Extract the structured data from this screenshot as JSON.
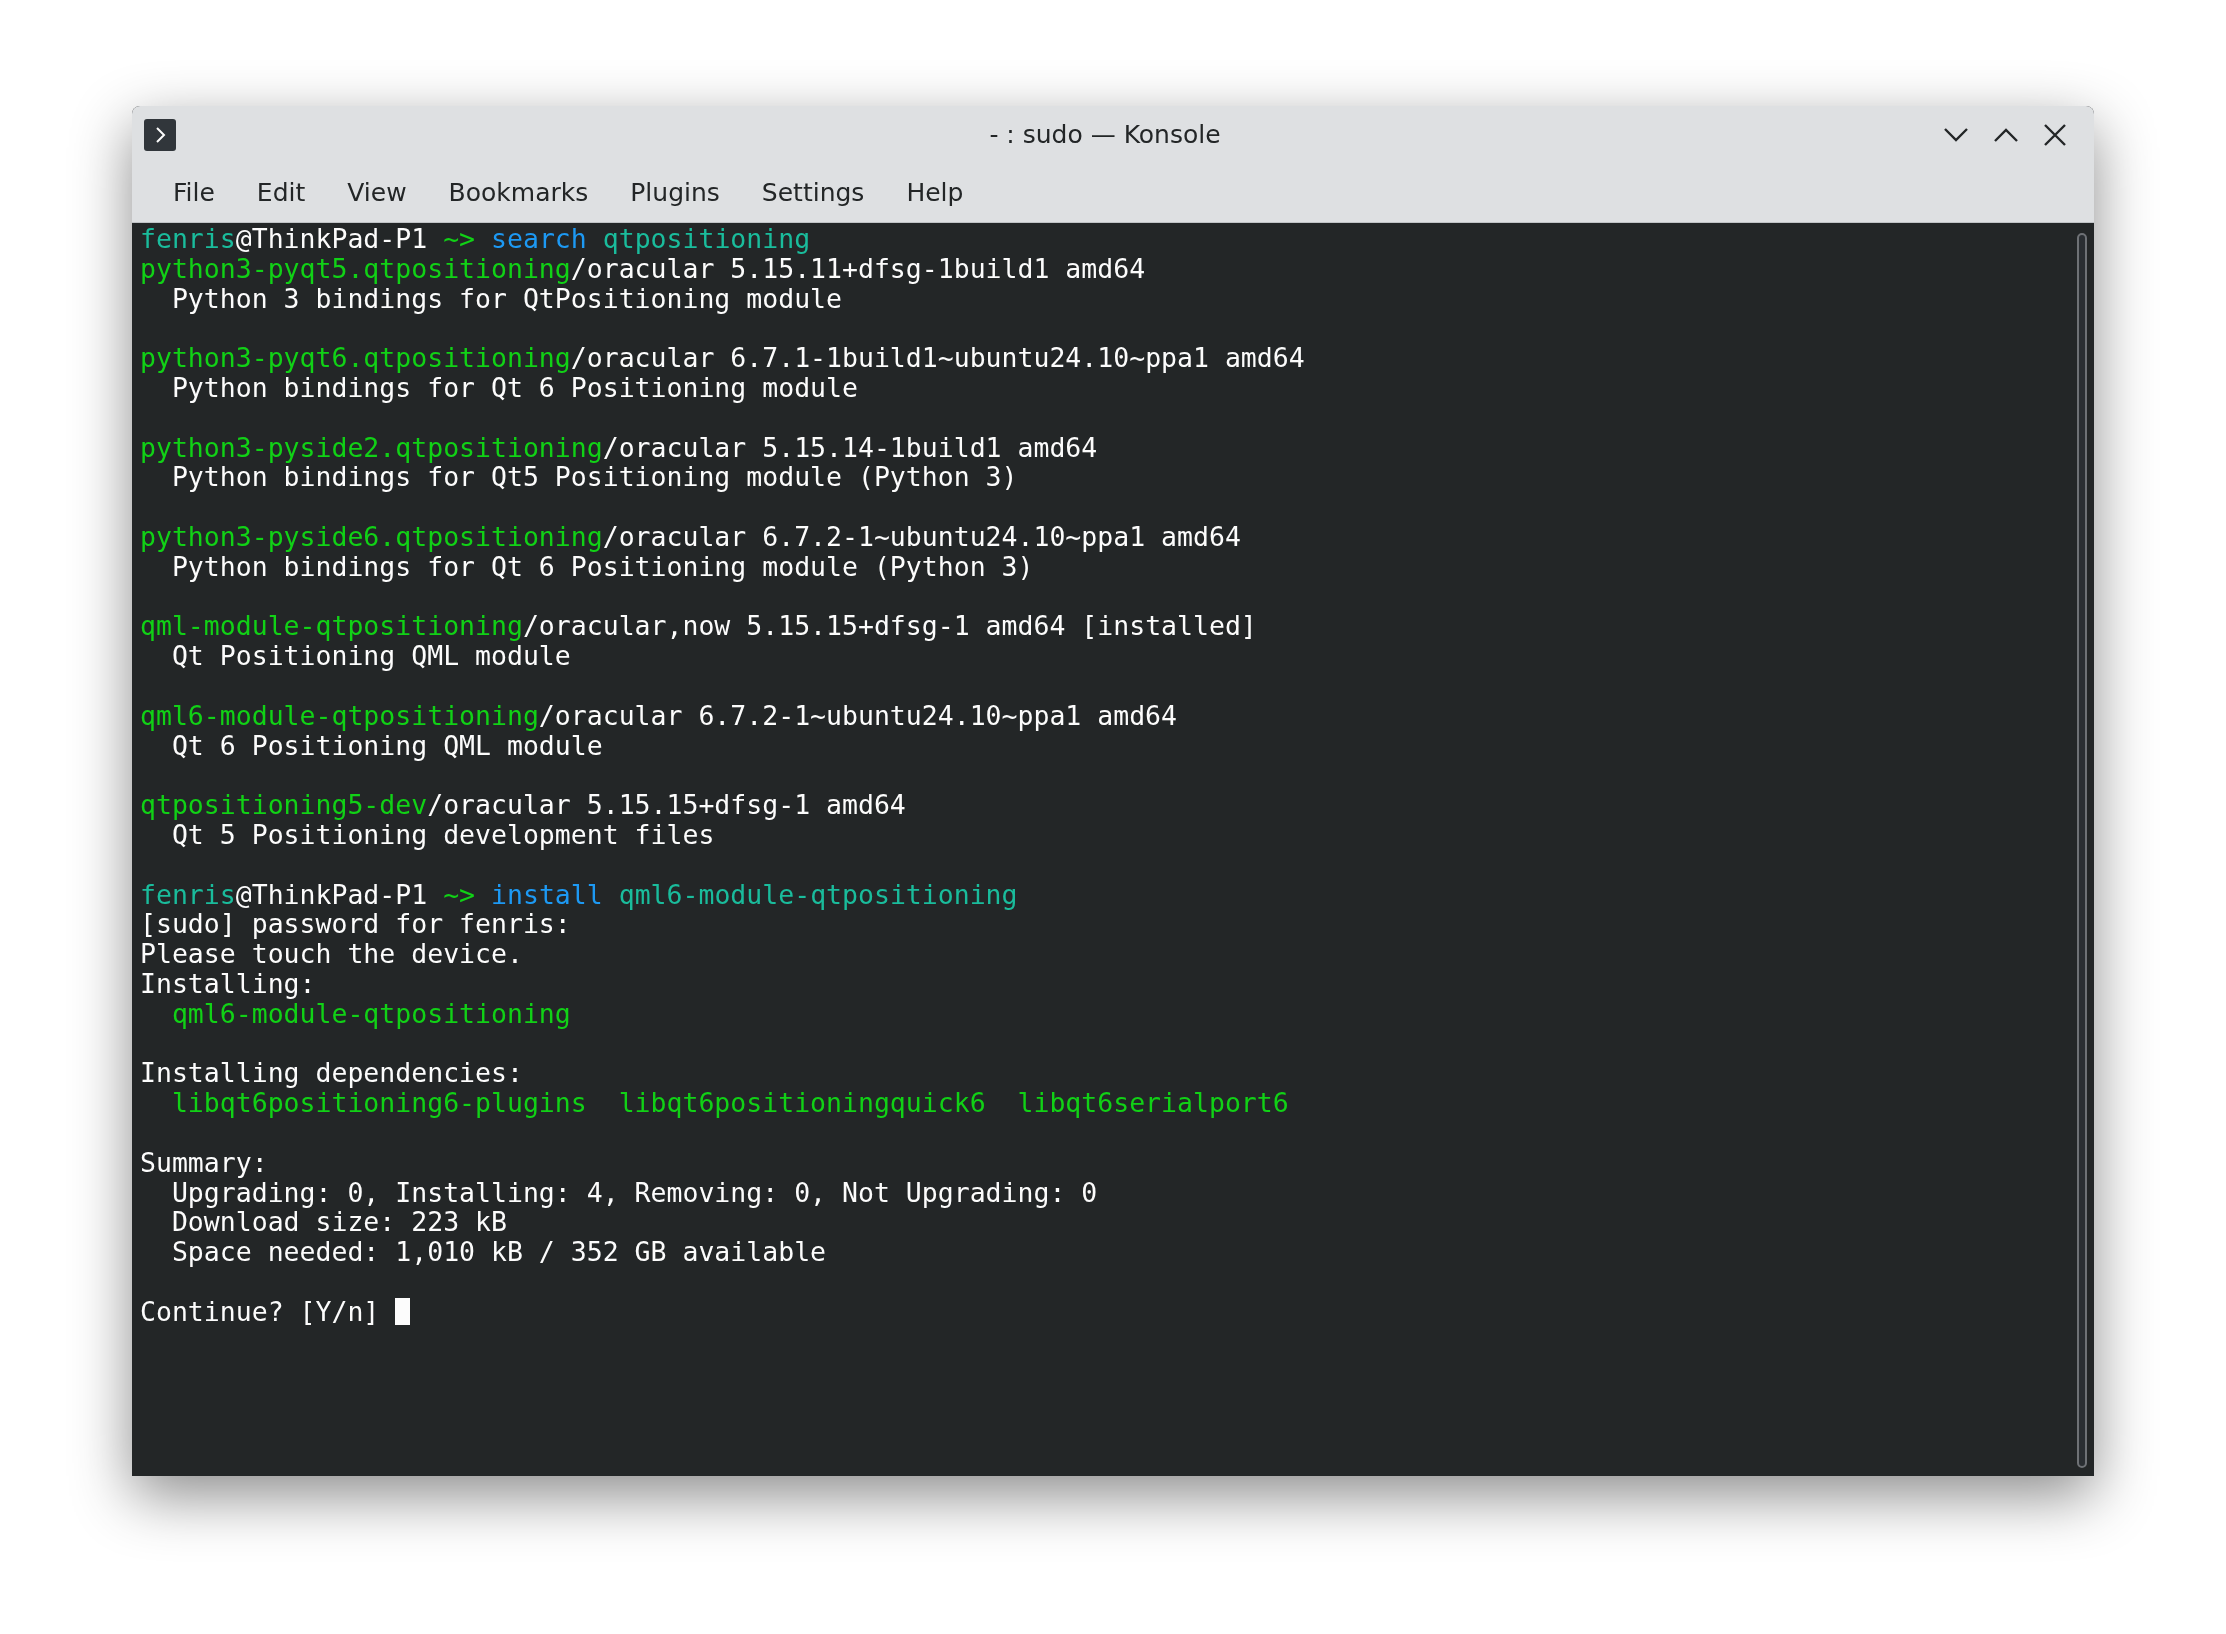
{
  "window": {
    "title": "- : sudo — Konsole"
  },
  "menu_bar": [
    "File",
    "Edit",
    "View",
    "Bookmarks",
    "Plugins",
    "Settings",
    "Help"
  ],
  "terminal": {
    "blocks": [
      {
        "lines": [
          {
            "segments": [
              {
                "text": "fenris",
                "color": "#1abc9c"
              },
              {
                "text": "@ThinkPad-P1 ",
                "color": "#fcfcfc"
              },
              {
                "text": "~>",
                "color": "#11d116"
              },
              {
                "text": " search",
                "color": "#1d99f3"
              },
              {
                "text": " qtpositioning",
                "color": "#1abc9c"
              }
            ]
          },
          {
            "segments": [
              {
                "text": "python3-pyqt5.qtpositioning",
                "color": "#11d116"
              },
              {
                "text": "/oracular 5.15.11+dfsg-1build1 amd64",
                "color": "#fcfcfc"
              }
            ]
          },
          {
            "segments": [
              {
                "text": "  Python 3 bindings for QtPositioning module",
                "color": "#fcfcfc"
              }
            ]
          }
        ]
      },
      {
        "lines": [
          {
            "segments": [
              {
                "text": "python3-pyqt6.qtpositioning",
                "color": "#11d116"
              },
              {
                "text": "/oracular 6.7.1-1build1~ubuntu24.10~ppa1 amd64",
                "color": "#fcfcfc"
              }
            ]
          },
          {
            "segments": [
              {
                "text": "  Python bindings for Qt 6 Positioning module",
                "color": "#fcfcfc"
              }
            ]
          }
        ]
      },
      {
        "lines": [
          {
            "segments": [
              {
                "text": "python3-pyside2.qtpositioning",
                "color": "#11d116"
              },
              {
                "text": "/oracular 5.15.14-1build1 amd64",
                "color": "#fcfcfc"
              }
            ]
          },
          {
            "segments": [
              {
                "text": "  Python bindings for Qt5 Positioning module (Python 3)",
                "color": "#fcfcfc"
              }
            ]
          }
        ]
      },
      {
        "lines": [
          {
            "segments": [
              {
                "text": "python3-pyside6.qtpositioning",
                "color": "#11d116"
              },
              {
                "text": "/oracular 6.7.2-1~ubuntu24.10~ppa1 amd64",
                "color": "#fcfcfc"
              }
            ]
          },
          {
            "segments": [
              {
                "text": "  Python bindings for Qt 6 Positioning module (Python 3)",
                "color": "#fcfcfc"
              }
            ]
          }
        ]
      },
      {
        "lines": [
          {
            "segments": [
              {
                "text": "qml-module-qtpositioning",
                "color": "#11d116"
              },
              {
                "text": "/oracular,now 5.15.15+dfsg-1 amd64 [installed]",
                "color": "#fcfcfc"
              }
            ]
          },
          {
            "segments": [
              {
                "text": "  Qt Positioning QML module",
                "color": "#fcfcfc"
              }
            ]
          }
        ]
      },
      {
        "lines": [
          {
            "segments": [
              {
                "text": "qml6-module-qtpositioning",
                "color": "#11d116"
              },
              {
                "text": "/oracular 6.7.2-1~ubuntu24.10~ppa1 amd64",
                "color": "#fcfcfc"
              }
            ]
          },
          {
            "segments": [
              {
                "text": "  Qt 6 Positioning QML module",
                "color": "#fcfcfc"
              }
            ]
          }
        ]
      },
      {
        "lines": [
          {
            "segments": [
              {
                "text": "qtpositioning5-dev",
                "color": "#11d116"
              },
              {
                "text": "/oracular 5.15.15+dfsg-1 amd64",
                "color": "#fcfcfc"
              }
            ]
          },
          {
            "segments": [
              {
                "text": "  Qt 5 Positioning development files",
                "color": "#fcfcfc"
              }
            ]
          }
        ]
      },
      {
        "lines": [
          {
            "segments": [
              {
                "text": "fenris",
                "color": "#1abc9c"
              },
              {
                "text": "@ThinkPad-P1 ",
                "color": "#fcfcfc"
              },
              {
                "text": "~>",
                "color": "#11d116"
              },
              {
                "text": " install",
                "color": "#1d99f3"
              },
              {
                "text": " qml6-module-qtpositioning",
                "color": "#1abc9c"
              }
            ]
          },
          {
            "segments": [
              {
                "text": "[sudo] password for fenris:",
                "color": "#fcfcfc"
              }
            ]
          },
          {
            "segments": [
              {
                "text": "Please touch the device.",
                "color": "#fcfcfc"
              }
            ]
          },
          {
            "segments": [
              {
                "text": "Installing:",
                "color": "#fcfcfc"
              }
            ]
          },
          {
            "segments": [
              {
                "text": "  qml6-module-qtpositioning",
                "color": "#11d116"
              }
            ]
          }
        ]
      },
      {
        "lines": [
          {
            "segments": [
              {
                "text": "Installing dependencies:",
                "color": "#fcfcfc"
              }
            ]
          },
          {
            "segments": [
              {
                "text": "  libqt6positioning6-plugins  libqt6positioningquick6  libqt6serialport6",
                "color": "#11d116"
              }
            ]
          }
        ]
      },
      {
        "lines": [
          {
            "segments": [
              {
                "text": "Summary:",
                "color": "#fcfcfc"
              }
            ]
          },
          {
            "segments": [
              {
                "text": "  Upgrading: 0, Installing: 4, Removing: 0, Not Upgrading: 0",
                "color": "#fcfcfc"
              }
            ]
          },
          {
            "segments": [
              {
                "text": "  Download size: 223 kB",
                "color": "#fcfcfc"
              }
            ]
          },
          {
            "segments": [
              {
                "text": "  Space needed: 1,010 kB / 352 GB available",
                "color": "#fcfcfc"
              }
            ]
          }
        ]
      },
      {
        "lines": [
          {
            "segments": [
              {
                "text": "Continue? [Y/n] ",
                "color": "#fcfcfc"
              }
            ],
            "cursor": true
          }
        ]
      }
    ]
  }
}
